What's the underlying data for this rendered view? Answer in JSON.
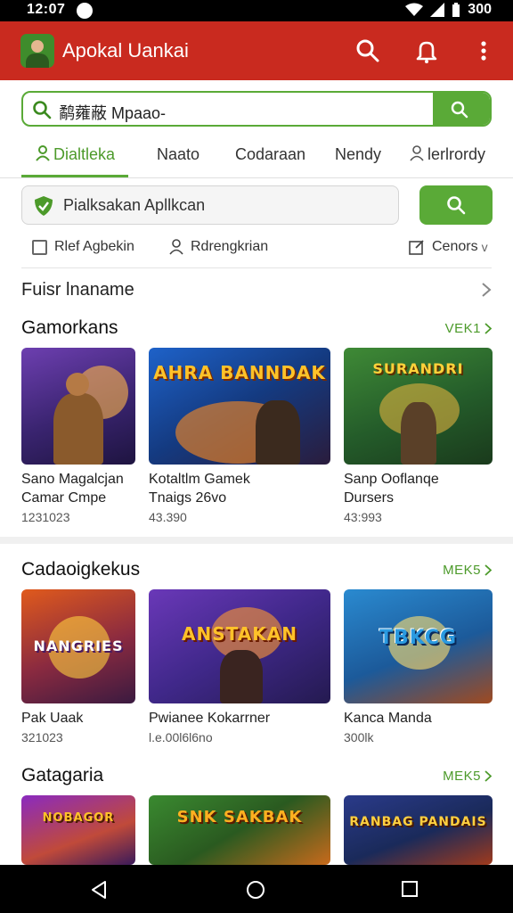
{
  "status_bar": {
    "time": "12:07",
    "battery": "300"
  },
  "app_bar": {
    "title": "Apokal Uankai",
    "icons": [
      "search-icon",
      "bell-icon",
      "more-vert-icon"
    ]
  },
  "search": {
    "value": "鹬蕹蔽 Mpaao-",
    "icon": "search-icon"
  },
  "tabs": [
    "Dialtleka",
    "Naato",
    "Codaraan",
    "Nendy",
    "lerlrordy"
  ],
  "filter": {
    "value": "Pialksakan Apllkcan"
  },
  "options": {
    "checkbox_label": "Rlef Agbekin",
    "sort_label": "Rdrengkrian",
    "more_label": "Cenors",
    "caret": "v"
  },
  "featured_row": {
    "title": "Fuisr lnaname"
  },
  "colors": {
    "accent_green": "#5aaa37",
    "app_bar_red": "#c92a1f",
    "link_green": "#4c9a2a"
  },
  "sections": [
    {
      "title": "Gamorkans",
      "more": "VEK1",
      "cards": [
        {
          "title_line1": "Sano Magalcjan",
          "title_line2": "Camar Cmpe",
          "meta": "1231023"
        },
        {
          "title_line1": "Kotaltlm Gamek",
          "title_line2": "Tnaigs 26vo",
          "meta": "43.390",
          "banner": "AHRA BANNDAK"
        },
        {
          "title_line1": "Sanp Ooflanqe",
          "title_line2": "Dursers",
          "meta": "43:993",
          "banner": "SURANDRI"
        }
      ]
    },
    {
      "title": "Cadaoigkekus",
      "more": "MEK5",
      "cards": [
        {
          "title_line1": "Pak Uaak",
          "meta": "321023",
          "banner": "NANGRIES"
        },
        {
          "title_line1": "Pwianee Kokarrner",
          "meta": "l.e.00l6l6no",
          "banner": "ANSTAKAN"
        },
        {
          "title_line1": "Kanca Manda",
          "meta": "300lk",
          "banner": "TBKCG"
        }
      ]
    },
    {
      "title": "Gatagaria",
      "more": "MEK5",
      "cards": [
        {
          "banner": "NOBAGOR"
        },
        {
          "banner": "SNK SAKBAK"
        },
        {
          "banner": "RANBAG PANDAIS"
        }
      ]
    }
  ]
}
